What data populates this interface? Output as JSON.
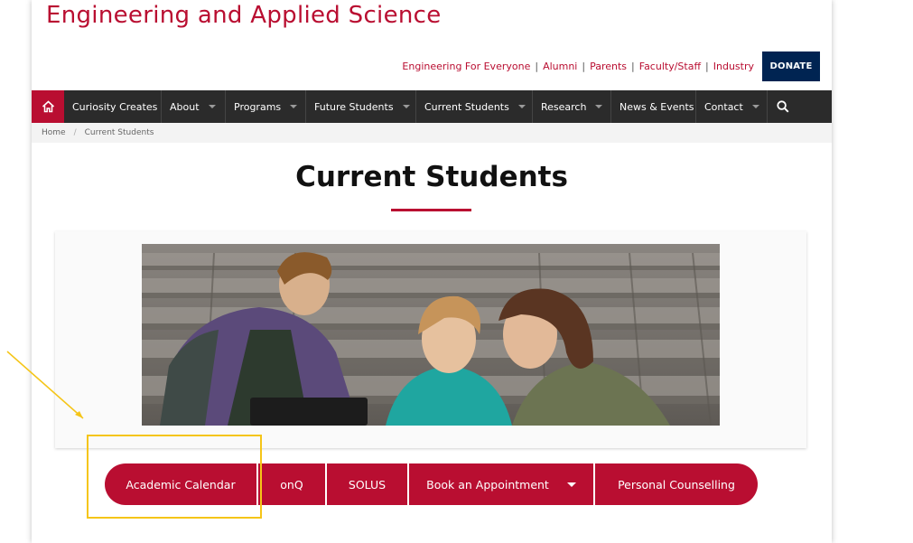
{
  "header": {
    "site_title": "Engineering and Applied Science",
    "utility_links": [
      "Engineering For Everyone",
      "Alumni",
      "Parents",
      "Faculty/Staff",
      "Industry"
    ],
    "donate_label": "DONATE"
  },
  "nav": {
    "home_icon": "home-icon",
    "items": [
      {
        "label": "Curiosity Creates",
        "dropdown": false
      },
      {
        "label": "About",
        "dropdown": true
      },
      {
        "label": "Programs",
        "dropdown": true
      },
      {
        "label": "Future Students",
        "dropdown": true
      },
      {
        "label": "Current Students",
        "dropdown": true
      },
      {
        "label": "Research",
        "dropdown": true
      },
      {
        "label": "News & Events",
        "dropdown": false
      },
      {
        "label": "Contact",
        "dropdown": true
      }
    ],
    "search_icon": "search-icon"
  },
  "breadcrumb": {
    "home": "Home",
    "current": "Current Students"
  },
  "main": {
    "title": "Current Students",
    "hero_image": "students-photo"
  },
  "quick_links": [
    {
      "label": "Academic Calendar",
      "dropdown": false
    },
    {
      "label": "onQ",
      "dropdown": false
    },
    {
      "label": "SOLUS",
      "dropdown": false
    },
    {
      "label": "Book an Appointment",
      "dropdown": true
    },
    {
      "label": "Personal Counselling",
      "dropdown": false
    }
  ],
  "colors": {
    "brand_red": "#b90e31",
    "navy": "#002452",
    "nav_dark": "#2b2b2b",
    "highlight": "#f5c518"
  }
}
